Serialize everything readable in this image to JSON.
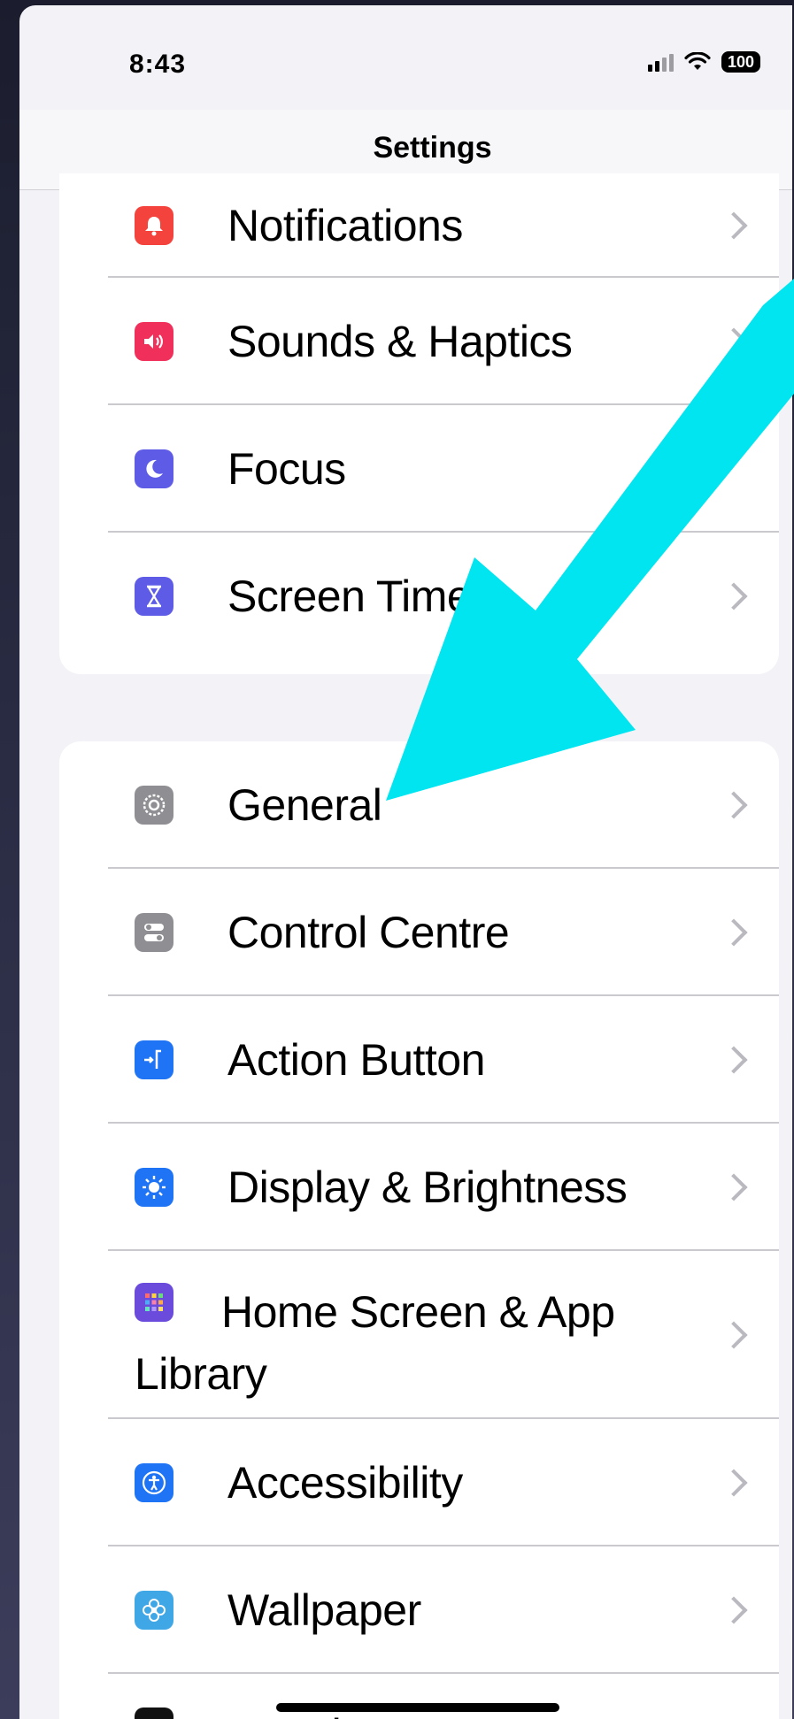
{
  "status_bar": {
    "time": "8:43",
    "battery": "100"
  },
  "nav": {
    "title": "Settings"
  },
  "group1": {
    "items": [
      {
        "label": "Notifications",
        "icon": "bell-icon",
        "color": "#f4433c"
      },
      {
        "label": "Sounds & Haptics",
        "icon": "speaker-icon",
        "color": "#f0305a"
      },
      {
        "label": "Focus",
        "icon": "moon-icon",
        "color": "#5e5ce6"
      },
      {
        "label": "Screen Time",
        "icon": "hourglass-icon",
        "color": "#5e5ce6"
      }
    ]
  },
  "group2": {
    "items": [
      {
        "label": "General",
        "icon": "gear-icon",
        "color": "#8e8e93"
      },
      {
        "label": "Control Centre",
        "icon": "toggles-icon",
        "color": "#8e8e93"
      },
      {
        "label": "Action Button",
        "icon": "action-button-icon",
        "color": "#1e74f5"
      },
      {
        "label": "Display & Brightness",
        "icon": "sun-icon",
        "color": "#1e74f5"
      },
      {
        "label": "Home Screen & App Library",
        "icon": "app-grid-icon",
        "color": "#6a4bdc"
      },
      {
        "label": "Accessibility",
        "icon": "accessibility-icon",
        "color": "#1e74f5"
      },
      {
        "label": "Wallpaper",
        "icon": "flower-icon",
        "color": "#3fa7e6"
      },
      {
        "label": "StandBy",
        "icon": "standby-icon",
        "color": "#111111"
      }
    ]
  },
  "annotation": {
    "arrow_color": "#00e5f0"
  }
}
